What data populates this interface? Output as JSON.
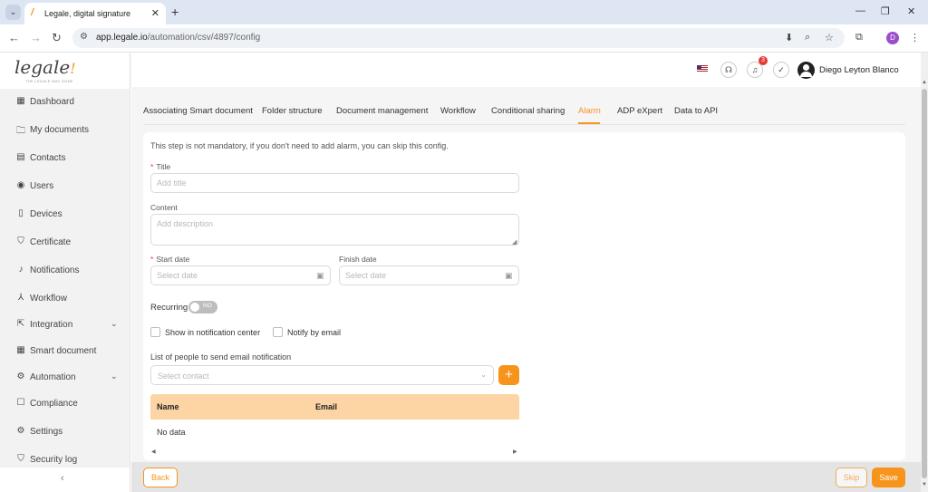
{
  "browser": {
    "tab_title": "Legale, digital signature",
    "url_host": "app.legale.io",
    "url_path": "/automation/csv/4897/config",
    "profile_initial": "D"
  },
  "logo": {
    "text": "legale",
    "tagline": "THE LEGALE WAY DONE"
  },
  "sidebar": {
    "items": [
      {
        "label": "Dashboard",
        "icon": "dashboard-icon",
        "glyph": "▦"
      },
      {
        "label": "My documents",
        "icon": "folder-icon",
        "glyph": "🗀"
      },
      {
        "label": "Contacts",
        "icon": "contacts-icon",
        "glyph": "▤"
      },
      {
        "label": "Users",
        "icon": "user-icon",
        "glyph": "◉"
      },
      {
        "label": "Devices",
        "icon": "device-icon",
        "glyph": "▯"
      },
      {
        "label": "Certificate",
        "icon": "certificate-icon",
        "glyph": "⛉"
      },
      {
        "label": "Notifications",
        "icon": "bell-icon",
        "glyph": "♪"
      },
      {
        "label": "Workflow",
        "icon": "workflow-icon",
        "glyph": "⅄"
      },
      {
        "label": "Integration",
        "icon": "integration-icon",
        "glyph": "⇱"
      },
      {
        "label": "Smart document",
        "icon": "smart-document-icon",
        "glyph": "▦"
      },
      {
        "label": "Automation",
        "icon": "automation-icon",
        "glyph": "⚙"
      },
      {
        "label": "Compliance",
        "icon": "compliance-icon",
        "glyph": "☐"
      },
      {
        "label": "Settings",
        "icon": "settings-icon",
        "glyph": "⚙"
      },
      {
        "label": "Security log",
        "icon": "security-log-icon",
        "glyph": "⛉"
      }
    ]
  },
  "header": {
    "notification_count": "3",
    "user_name": "Diego Leyton Blanco"
  },
  "tabs": [
    {
      "label": "Associating Smart document"
    },
    {
      "label": "Folder structure"
    },
    {
      "label": "Document management"
    },
    {
      "label": "Workflow"
    },
    {
      "label": "Conditional sharing"
    },
    {
      "label": "Alarm"
    },
    {
      "label": "ADP eXpert"
    },
    {
      "label": "Data to API"
    }
  ],
  "form": {
    "hint": "This step is not mandatory, if you don't need to add alarm, you can skip this config.",
    "title_label": "Title",
    "title_placeholder": "Add title",
    "content_label": "Content",
    "content_placeholder": "Add description",
    "start_label": "Start date",
    "start_placeholder": "Select date",
    "finish_label": "Finish date",
    "finish_placeholder": "Select date",
    "recurring_label": "Recurring",
    "recurring_value": "NO",
    "show_in_center_label": "Show in notification center",
    "notify_email_label": "Notify by email",
    "people_label": "List of people to send email notification",
    "contact_placeholder": "Select contact",
    "add_symbol": "+"
  },
  "table": {
    "columns": [
      "Name",
      "Email"
    ],
    "empty_text": "No data"
  },
  "footer": {
    "back": "Back",
    "skip": "Skip",
    "save": "Save"
  },
  "colors": {
    "accent": "#f7941d",
    "table_header": "#fdd4a3",
    "badge": "#e53935"
  }
}
